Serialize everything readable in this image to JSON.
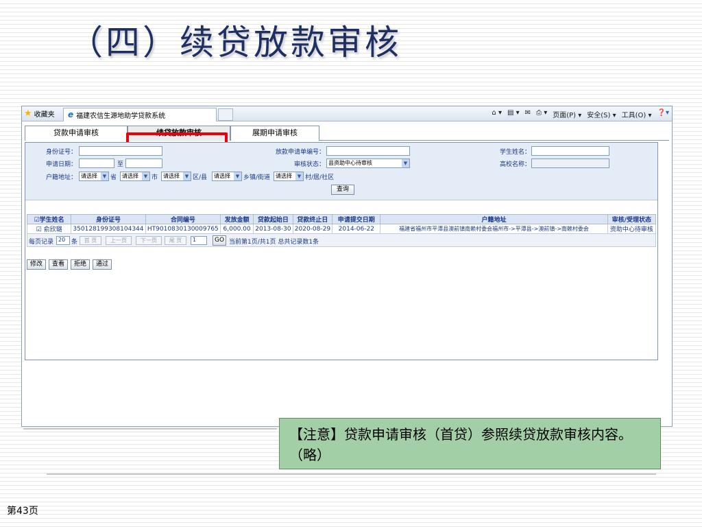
{
  "slide": {
    "title": "（四）续贷放款审核",
    "note": "【注意】贷款申请审核（首贷）参照续贷放款审核内容。（略）",
    "page_number": "第43页"
  },
  "browser": {
    "favorites_label": "收藏夹",
    "tab_title": "福建农信生源地助学贷款系统",
    "toolbar_items": [
      "页面(P)",
      "安全(S)",
      "工具(O)"
    ]
  },
  "tabs": [
    {
      "label": "贷款申请审核",
      "active": false
    },
    {
      "label": "续贷放款审核",
      "active": true
    },
    {
      "label": "展期申请审核",
      "active": false
    }
  ],
  "search": {
    "id_label": "身份证号：",
    "apply_date_label": "申请日期：",
    "date_to": "至",
    "address_label": "户籍地址：",
    "loan_no_label": "放款申请单编号：",
    "status_label": "审核状态：",
    "status_value": "县资助中心待审核",
    "student_name_label": "学生姓名：",
    "school_label": "高校名称：",
    "select_placeholder": "请选择",
    "province": "省",
    "city": "市",
    "district": "区/县",
    "town": "乡镇/街道",
    "village": "村/居/社区",
    "query_button": "查询"
  },
  "table": {
    "columns": [
      "学生姓名",
      "身份证号",
      "合同编号",
      "发放金额",
      "贷款起始日",
      "贷款终止日",
      "申请提交日期",
      "户籍地址",
      "审核/受理状态"
    ],
    "rows": [
      {
        "name": "俞欣璐",
        "id": "350128199308104344",
        "contract": "HT9010830130009765",
        "amount": "6,000.00",
        "start": "2013-08-30",
        "end": "2020-08-29",
        "submit": "2014-06-22",
        "address": "福建省福州市平潭县澳前镇南赖村委会福州市->平潭县->澳前镇->南赖村委会",
        "status": "资助中心待审核"
      }
    ]
  },
  "pager": {
    "per_page_label": "每页记录",
    "per_page_value": "20",
    "per_page_unit": "条",
    "first": "首 页",
    "prev": "上一页",
    "next": "下一页",
    "last": "尾 页",
    "page_input": "1",
    "go": "GO",
    "summary": "当前第1页/共1页 总共记录数1条"
  },
  "actions": [
    "修改",
    "查看",
    "拒绝",
    "通过"
  ]
}
